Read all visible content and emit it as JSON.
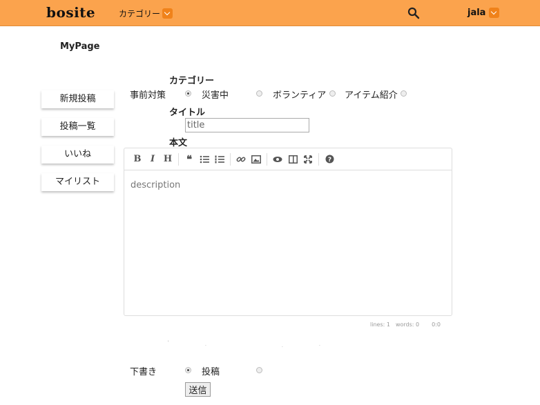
{
  "header": {
    "logo": "bosite",
    "category_menu": "カテゴリー",
    "user": "jala"
  },
  "page_title": "MyPage",
  "sidebar": {
    "items": [
      {
        "label": "新規投稿"
      },
      {
        "label": "投稿一覧"
      },
      {
        "label": "いいね"
      },
      {
        "label": "マイリスト"
      }
    ]
  },
  "form": {
    "category_label": "カテゴリー",
    "categories": [
      {
        "label": "事前対策",
        "selected": true
      },
      {
        "label": "災害中",
        "selected": false
      },
      {
        "label": "ボランティア",
        "selected": false
      },
      {
        "label": "アイテム紹介",
        "selected": false
      }
    ],
    "title_label": "タイトル",
    "title_placeholder": "title",
    "body_label": "本文",
    "body_placeholder": "description",
    "editor_status": {
      "lines": "lines: 1",
      "words": "words: 0",
      "cursor": "0:0"
    },
    "status_options": [
      {
        "label": "下書き",
        "selected": true
      },
      {
        "label": "投稿",
        "selected": false
      }
    ],
    "submit_label": "送信"
  },
  "colors": {
    "header_bg": "#fba34d",
    "dropdown_accent": "#f0821a"
  }
}
